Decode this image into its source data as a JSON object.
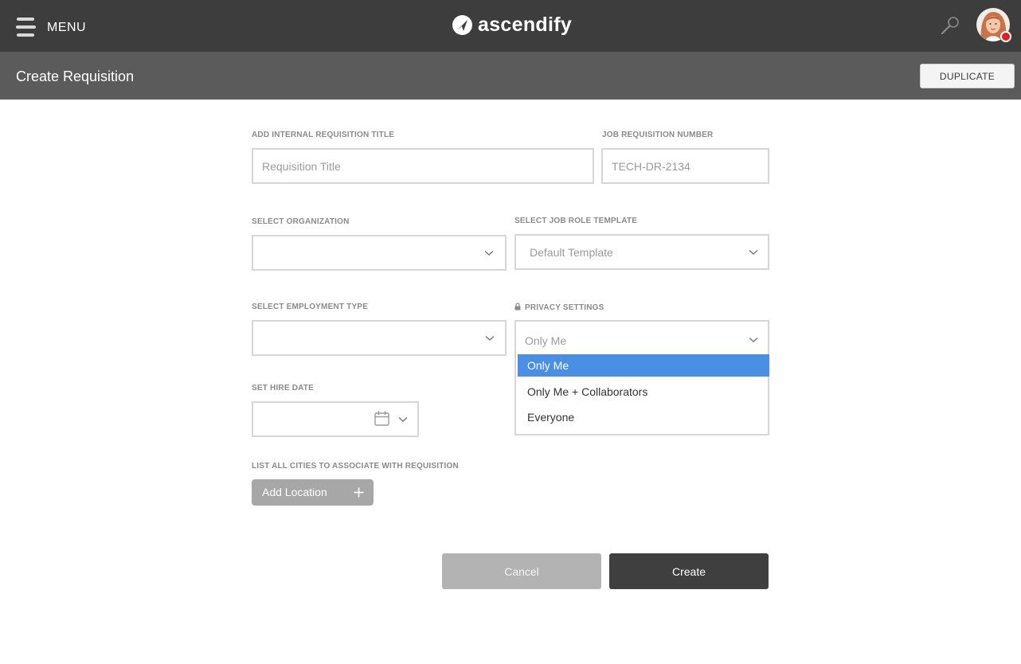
{
  "header": {
    "menu_label": "MENU",
    "brand_name": "ascendify"
  },
  "page": {
    "title": "Create Requisition",
    "duplicate_label": "DUPLICATE"
  },
  "form": {
    "req_title": {
      "label": "ADD INTERNAL REQUISITION TITLE",
      "placeholder": "Requisition Title"
    },
    "req_number": {
      "label": "JOB REQUISITION NUMBER",
      "placeholder": "TECH-DR-2134"
    },
    "organization": {
      "label": "SELECT ORGANIZATION",
      "value": ""
    },
    "job_role_template": {
      "label": "SELECT JOB ROLE TEMPLATE",
      "value": "Default Template"
    },
    "employment_type": {
      "label": "SELECT EMPLOYMENT TYPE",
      "value": ""
    },
    "privacy": {
      "label": "PRIVACY SETTINGS",
      "value": "Only Me",
      "options": [
        "Only Me",
        "Only Me + Collaborators",
        "Everyone"
      ],
      "selected_index": 0
    },
    "hire_date": {
      "label": "SET HIRE DATE",
      "value": ""
    },
    "locations": {
      "label": "LIST ALL CITIES TO ASSOCIATE WITH REQUISITION",
      "add_label": "Add Location"
    }
  },
  "actions": {
    "cancel_label": "Cancel",
    "create_label": "Create"
  },
  "colors": {
    "topbar": "#3d3d3d",
    "pagebar": "#5b5b5b",
    "selected_option": "#4a8fe3",
    "notification_dot": "#e11d1d",
    "create_button": "#3f3f3f",
    "cancel_button": "#b3b3b3"
  },
  "icons": {
    "menu": "hamburger-icon",
    "brand": "ascendify-logo-icon",
    "search": "search-icon",
    "chevron": "chevron-down-icon",
    "calendar": "calendar-icon",
    "lock": "lock-icon",
    "plus": "plus-icon"
  }
}
